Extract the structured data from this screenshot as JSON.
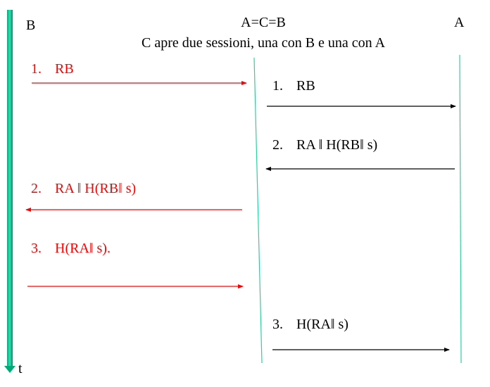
{
  "participants": {
    "left": "B",
    "middle": "A=C=B",
    "right": "A",
    "time_axis": "t"
  },
  "subtitle": "C apre due sessioni, una con B e una con A",
  "colors": {
    "attack": "#ff0000",
    "normal": "#000000",
    "lifeline": "#2bd1a0",
    "time_axis": "#009966"
  },
  "messages_b_c": [
    {
      "num": "1.",
      "text": "RB",
      "direction": "to-middle"
    },
    {
      "num": "2.",
      "text": "RA ‖ H(RB‖ s)",
      "direction": "to-left"
    },
    {
      "num": "3.",
      "text": "H(RA‖ s).",
      "direction": "to-middle"
    }
  ],
  "messages_c_a": [
    {
      "num": "1.",
      "text": "RB",
      "direction": "to-right"
    },
    {
      "num": "2.",
      "text": "RA ‖ H(RB‖ s)",
      "direction": "to-middle"
    },
    {
      "num": "3.",
      "text": "H(RA‖ s)",
      "direction": "to-right"
    }
  ]
}
